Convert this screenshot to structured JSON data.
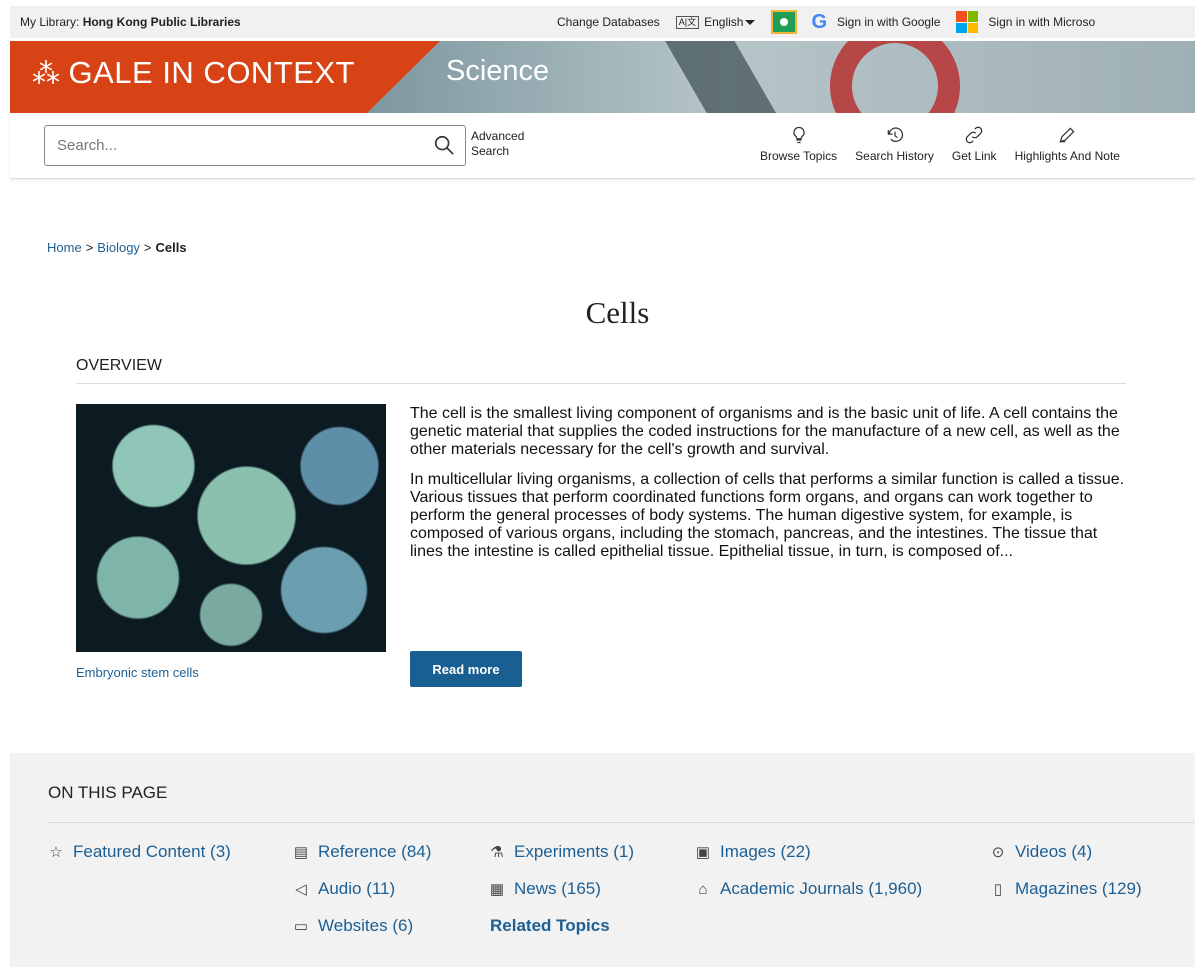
{
  "utility": {
    "library_label": "My Library:",
    "library_name": "Hong Kong Public Libraries",
    "change_databases": "Change Databases",
    "language_icon_text": "A|文",
    "language": "English",
    "google_signin": "Sign in with Google",
    "microsoft_signin": "Sign in with Microso"
  },
  "banner": {
    "brand": "GALE IN CONTEXT",
    "subject": "Science"
  },
  "search": {
    "placeholder": "Search...",
    "advanced_line1": "Advanced",
    "advanced_line2": "Search"
  },
  "tools": [
    {
      "label": "Browse Topics",
      "icon": "lightbulb-icon"
    },
    {
      "label": "Search History",
      "icon": "history-icon"
    },
    {
      "label": "Get Link",
      "icon": "link-icon"
    },
    {
      "label": "Highlights And Note",
      "icon": "pen-icon"
    }
  ],
  "breadcrumb": {
    "home": "Home",
    "biology": "Biology",
    "current": "Cells",
    "separator": ">"
  },
  "page_title": "Cells",
  "overview": {
    "heading": "OVERVIEW",
    "image_caption": "Embryonic stem cells",
    "paragraph1": "The cell is the smallest living component of organisms and is the basic unit of life. A cell contains the genetic material that supplies the coded instructions for the manufacture of a new cell, as well as the other materials necessary for the cell's growth and survival.",
    "paragraph2": "In multicellular living organisms, a collection of cells that performs a similar function is called a tissue. Various tissues that perform coordinated functions form organs, and organs can work together to perform the general processes of body systems. The human digestive system, for example, is composed of various organs, including the stomach, pancreas, and the intestines. The tissue that lines the intestine is called epithelial tissue. Epithelial tissue, in turn, is composed of...",
    "read_more": "Read more"
  },
  "on_this_page": {
    "heading": "ON THIS PAGE",
    "links": {
      "featured": "Featured Content (3)",
      "reference": "Reference (84)",
      "experiments": "Experiments (1)",
      "images": "Images (22)",
      "videos": "Videos (4)",
      "audio": "Audio (11)",
      "news": "News (165)",
      "journals": "Academic Journals (1,960)",
      "magazines": "Magazines (129)",
      "websites": "Websites (6)",
      "related": "Related Topics"
    }
  },
  "colors": {
    "brand_orange": "#d84315",
    "link_blue": "#1d5f93",
    "button_blue": "#1a5f91"
  }
}
